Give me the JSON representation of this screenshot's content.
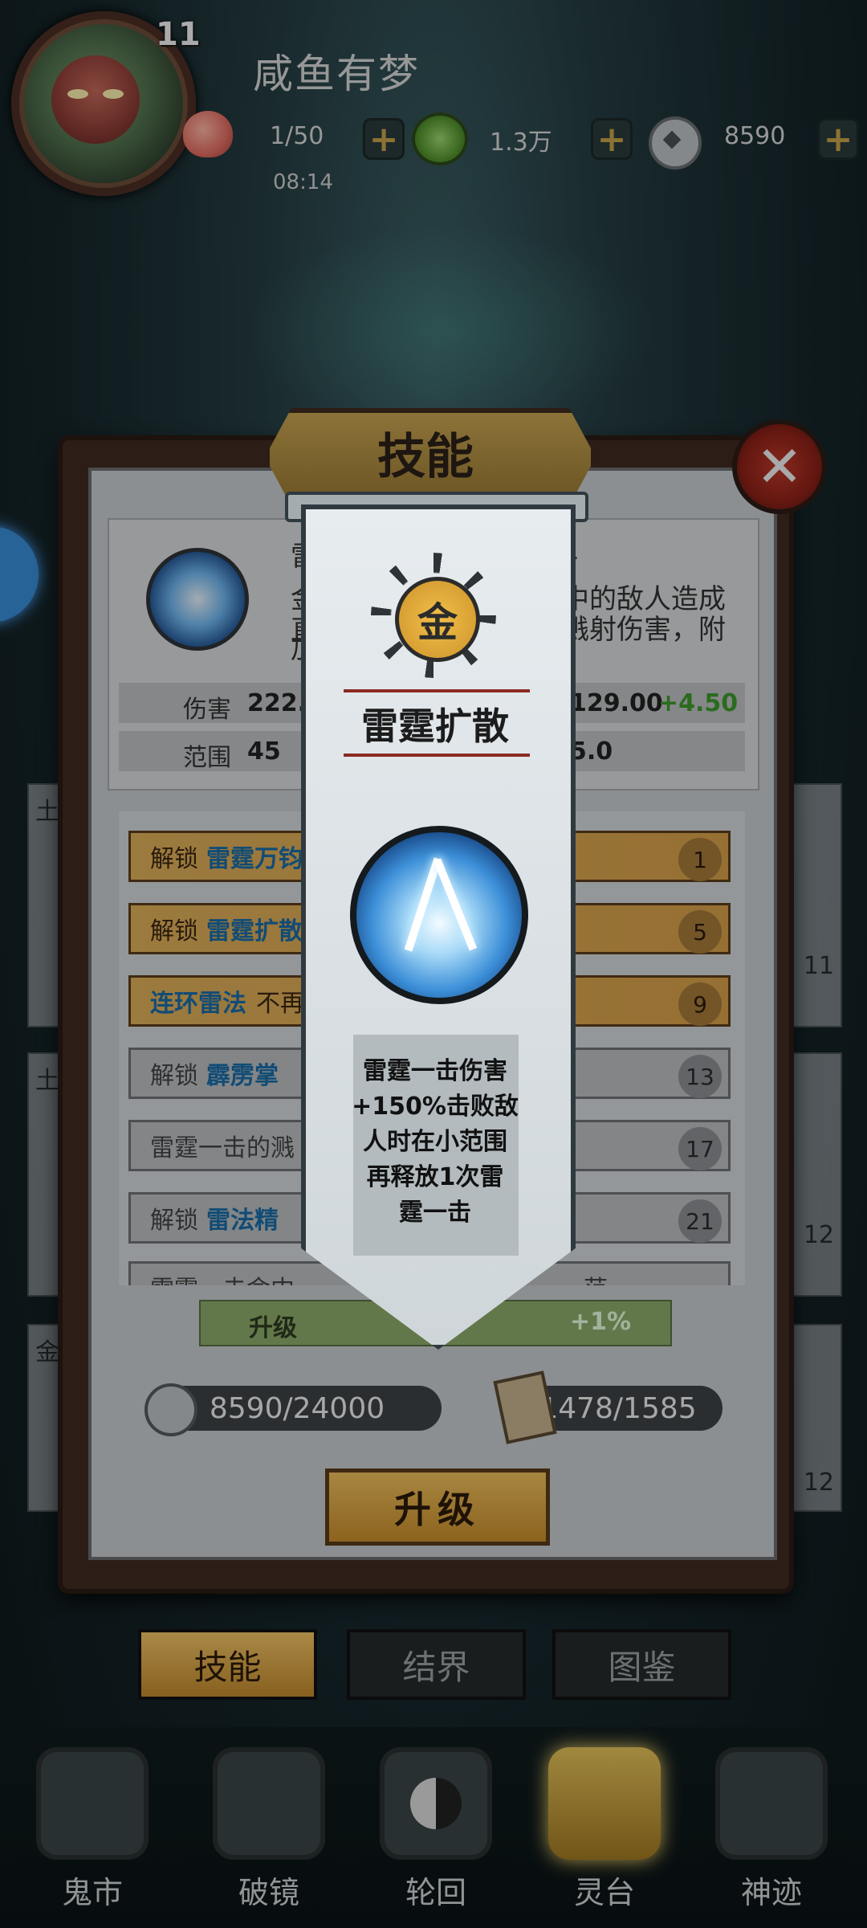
{
  "player": {
    "level": "11",
    "name": "咸鱼有梦",
    "stamina": "1/50",
    "stamina_timer": "08:14",
    "jade": "1.3万",
    "coins": "8590"
  },
  "panel": {
    "title": "技能",
    "header": {
      "name_fragment": "雷",
      "level_fragment": "1",
      "desc_left_1": "金",
      "desc_left_2": "直",
      "desc_left_3": "加",
      "desc_right_1": "中的敌人造成",
      "desc_right_2": "溅射伤害，附"
    },
    "stats": [
      {
        "label": "伤害",
        "value": "222.",
        "right_value": "129.00",
        "gain": "+4.50"
      },
      {
        "label": "范围",
        "value": "45",
        "right_value": "5.0"
      }
    ],
    "unlock_rows": [
      {
        "prefix": "解锁",
        "skill": "雷霆万钧",
        "level": "1",
        "style": "gold"
      },
      {
        "prefix": "解锁",
        "skill": "雷霆扩散",
        "level": "5",
        "style": "gold"
      },
      {
        "prefix": "",
        "skill": "连环雷法",
        "suffix": "不再",
        "level": "9",
        "style": "gold"
      },
      {
        "prefix": "解锁",
        "skill": "霹雳掌",
        "level": "13",
        "style": "grey"
      },
      {
        "prefix": "雷霆一击的溅",
        "skill": "",
        "level": "17",
        "style": "grey"
      },
      {
        "prefix": "解锁",
        "skill": "雷法精",
        "level": "21",
        "style": "grey"
      },
      {
        "prefix": "雷霆一击命中",
        "skill": "",
        "suffix": "范",
        "level": "",
        "style": "grey"
      }
    ],
    "bonus_left": "升级",
    "bonus_right": "+1%",
    "cost_coins": "8590/24000",
    "cost_scrolls": "1478/1585",
    "upgrade_label": "升级"
  },
  "side_cards": {
    "left_labels": [
      "土",
      "土",
      "金"
    ],
    "right_labels": [
      "11",
      "12",
      "12"
    ]
  },
  "tabs": [
    "技能",
    "结界",
    "图鉴"
  ],
  "nav": [
    "鬼市",
    "破镜",
    "轮回",
    "灵台",
    "神迹"
  ],
  "banner": {
    "element": "金",
    "title": "雷霆扩散",
    "description": [
      "雷霆一击伤害",
      "+150%击败敌",
      "人时在小范围",
      "再释放1次雷",
      "霆一击"
    ]
  },
  "icons": {
    "close": "close-icon",
    "peach": "peach-icon",
    "jade": "jade-coin-icon",
    "coin": "square-hole-coin-icon",
    "scroll": "scroll-icon",
    "lightning": "lightning-skill-icon"
  },
  "colors": {
    "gold": "#d7a14a",
    "accent_blue": "#1a6ea8",
    "gain_green": "#3e9a2b",
    "close_red": "#c0392b"
  }
}
